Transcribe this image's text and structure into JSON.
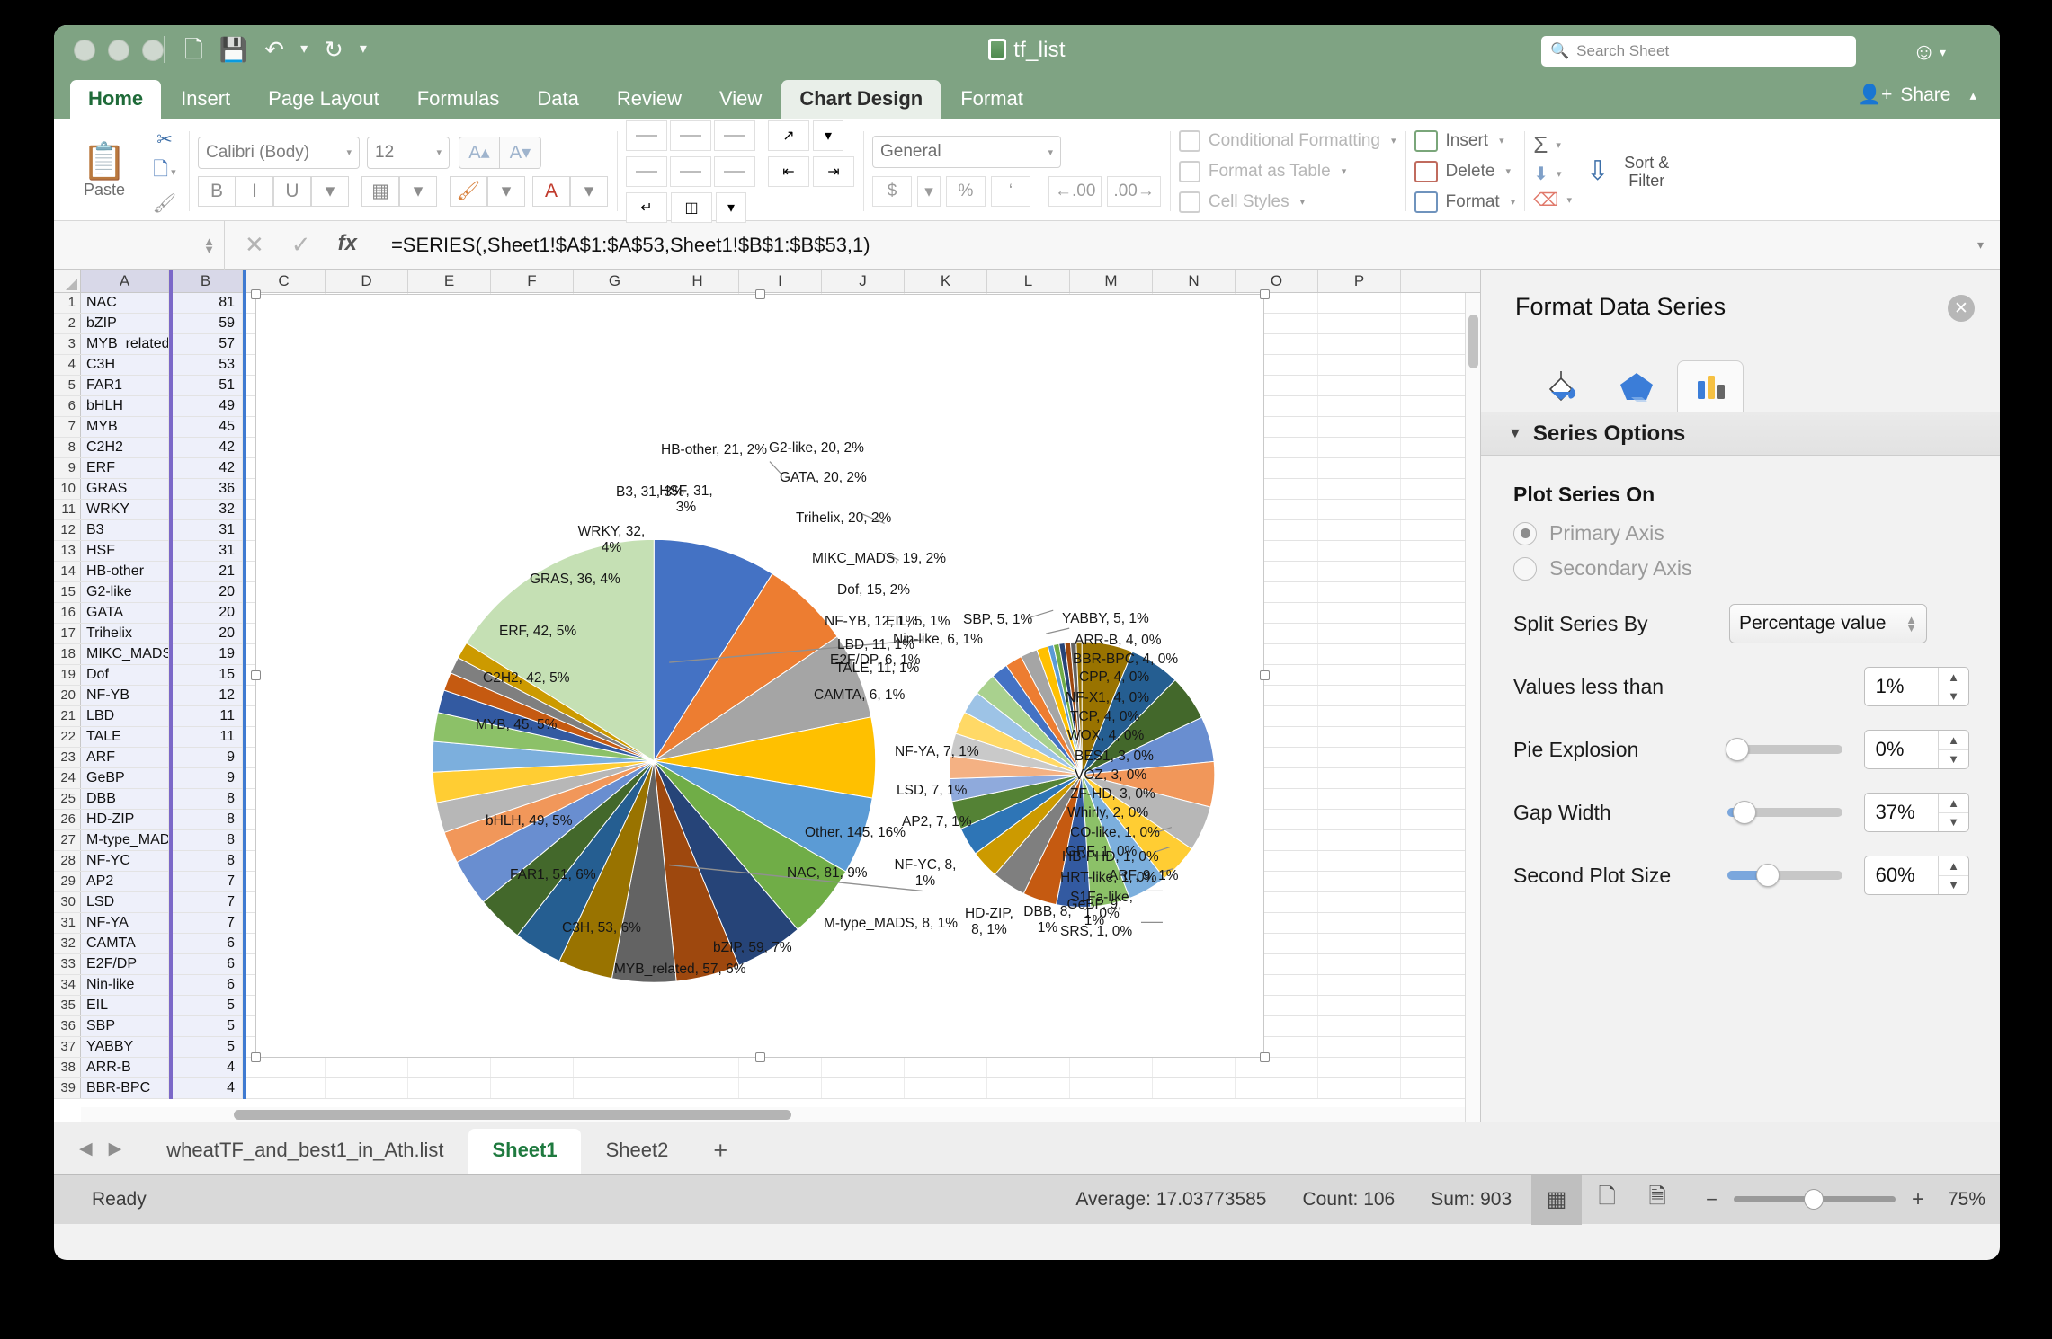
{
  "window": {
    "title": "tf_list",
    "search_placeholder": "Search Sheet",
    "quick_access": [
      "new-icon",
      "save-icon",
      "undo-icon",
      "redo-icon",
      "customize-icon"
    ],
    "share_label": "Share"
  },
  "ribbon": {
    "tabs": [
      {
        "label": "Home",
        "state": "active"
      },
      {
        "label": "Insert",
        "state": "normal"
      },
      {
        "label": "Page Layout",
        "state": "normal"
      },
      {
        "label": "Formulas",
        "state": "normal"
      },
      {
        "label": "Data",
        "state": "normal"
      },
      {
        "label": "Review",
        "state": "normal"
      },
      {
        "label": "View",
        "state": "normal"
      },
      {
        "label": "Chart Design",
        "state": "contextual"
      },
      {
        "label": "Format",
        "state": "contextual-plain"
      }
    ],
    "clipboard": {
      "paste_label": "Paste"
    },
    "font": {
      "name": "Calibri (Body)",
      "size": "12",
      "grow": "A",
      "shrink": "A",
      "bold": "B",
      "italic": "I",
      "underline": "U"
    },
    "number": {
      "format": "General",
      "currency": "$",
      "percent": "%",
      "comma": "'",
      "inc_dec": ".00",
      "dec_dec": ".00"
    },
    "styles": [
      {
        "label": "Conditional Formatting"
      },
      {
        "label": "Format as Table"
      },
      {
        "label": "Cell Styles"
      }
    ],
    "cells": [
      {
        "label": "Insert"
      },
      {
        "label": "Delete"
      },
      {
        "label": "Format"
      }
    ],
    "editing": {
      "sort_filter": "Sort & Filter"
    }
  },
  "formula_bar": {
    "name_box": "",
    "formula": "=SERIES(,Sheet1!$A$1:$A$53,Sheet1!$B$1:$B$53,1)"
  },
  "grid": {
    "columns": [
      "A",
      "B",
      "C",
      "D",
      "E",
      "F",
      "G",
      "H",
      "I",
      "J",
      "K",
      "L",
      "M",
      "N",
      "O",
      "P"
    ],
    "selected_columns": [
      "A",
      "B"
    ],
    "rows": [
      {
        "n": 1,
        "a": "NAC",
        "b": "81"
      },
      {
        "n": 2,
        "a": "bZIP",
        "b": "59"
      },
      {
        "n": 3,
        "a": "MYB_related",
        "b": "57"
      },
      {
        "n": 4,
        "a": "C3H",
        "b": "53"
      },
      {
        "n": 5,
        "a": "FAR1",
        "b": "51"
      },
      {
        "n": 6,
        "a": "bHLH",
        "b": "49"
      },
      {
        "n": 7,
        "a": "MYB",
        "b": "45"
      },
      {
        "n": 8,
        "a": "C2H2",
        "b": "42"
      },
      {
        "n": 9,
        "a": "ERF",
        "b": "42"
      },
      {
        "n": 10,
        "a": "GRAS",
        "b": "36"
      },
      {
        "n": 11,
        "a": "WRKY",
        "b": "32"
      },
      {
        "n": 12,
        "a": "B3",
        "b": "31"
      },
      {
        "n": 13,
        "a": "HSF",
        "b": "31"
      },
      {
        "n": 14,
        "a": "HB-other",
        "b": "21"
      },
      {
        "n": 15,
        "a": "G2-like",
        "b": "20"
      },
      {
        "n": 16,
        "a": "GATA",
        "b": "20"
      },
      {
        "n": 17,
        "a": "Trihelix",
        "b": "20"
      },
      {
        "n": 18,
        "a": "MIKC_MADS",
        "b": "19"
      },
      {
        "n": 19,
        "a": "Dof",
        "b": "15"
      },
      {
        "n": 20,
        "a": "NF-YB",
        "b": "12"
      },
      {
        "n": 21,
        "a": "LBD",
        "b": "11"
      },
      {
        "n": 22,
        "a": "TALE",
        "b": "11"
      },
      {
        "n": 23,
        "a": "ARF",
        "b": "9"
      },
      {
        "n": 24,
        "a": "GeBP",
        "b": "9"
      },
      {
        "n": 25,
        "a": "DBB",
        "b": "8"
      },
      {
        "n": 26,
        "a": "HD-ZIP",
        "b": "8"
      },
      {
        "n": 27,
        "a": "M-type_MADS",
        "b": "8"
      },
      {
        "n": 28,
        "a": "NF-YC",
        "b": "8"
      },
      {
        "n": 29,
        "a": "AP2",
        "b": "7"
      },
      {
        "n": 30,
        "a": "LSD",
        "b": "7"
      },
      {
        "n": 31,
        "a": "NF-YA",
        "b": "7"
      },
      {
        "n": 32,
        "a": "CAMTA",
        "b": "6"
      },
      {
        "n": 33,
        "a": "E2F/DP",
        "b": "6"
      },
      {
        "n": 34,
        "a": "Nin-like",
        "b": "6"
      },
      {
        "n": 35,
        "a": "EIL",
        "b": "5"
      },
      {
        "n": 36,
        "a": "SBP",
        "b": "5"
      },
      {
        "n": 37,
        "a": "YABBY",
        "b": "5"
      },
      {
        "n": 38,
        "a": "ARR-B",
        "b": "4"
      },
      {
        "n": 39,
        "a": "BBR-BPC",
        "b": "4"
      }
    ]
  },
  "chart_data": {
    "type": "pie",
    "variant": "pie-of-pie",
    "title": "",
    "total": 903,
    "main_pie": {
      "labels": [
        "NAC",
        "bZIP",
        "MYB_related",
        "C3H",
        "FAR1",
        "bHLH",
        "MYB",
        "C2H2",
        "ERF",
        "GRAS",
        "WRKY",
        "B3",
        "HSF",
        "HB-other",
        "G2-like",
        "GATA",
        "Trihelix",
        "MIKC_MADS",
        "Dof",
        "NF-YB",
        "LBD",
        "TALE",
        "Other"
      ],
      "values": [
        81,
        59,
        57,
        53,
        51,
        49,
        45,
        42,
        42,
        36,
        32,
        31,
        31,
        21,
        20,
        20,
        20,
        19,
        15,
        12,
        11,
        11,
        145
      ],
      "percents": [
        "9%",
        "7%",
        "6%",
        "6%",
        "6%",
        "5%",
        "5%",
        "5%",
        "5%",
        "4%",
        "4%",
        "3%",
        "3%",
        "2%",
        "2%",
        "2%",
        "2%",
        "2%",
        "2%",
        "1%",
        "1%",
        "1%",
        "16%"
      ],
      "data_labels": [
        "NAC, 81, 9%",
        "bZIP, 59, 7%",
        "MYB_related, 57, 6%",
        "C3H, 53, 6%",
        "FAR1, 51, 6%",
        "bHLH, 49, 5%",
        "MYB, 45, 5%",
        "C2H2, 42, 5%",
        "ERF, 42, 5%",
        "GRAS, 36, 4%",
        "WRKY, 32, 4%",
        "B3, 31, 3%",
        "HSF, 31, 3%",
        "HB-other, 21, 2%",
        "G2-like, 20, 2%",
        "GATA, 20, 2%",
        "Trihelix, 20, 2%",
        "MIKC_MADS, 19, 2%",
        "Dof, 15, 2%",
        "NF-YB, 12, 1%",
        "LBD, 11, 1%",
        "TALE, 11, 1%",
        "Other, 145, 16%"
      ]
    },
    "secondary_pie": {
      "labels": [
        "ARF",
        "GeBP",
        "DBB",
        "HD-ZIP",
        "M-type_MADS",
        "NF-YC",
        "AP2",
        "LSD",
        "NF-YA",
        "CAMTA",
        "E2F/DP",
        "Nin-like",
        "EIL",
        "SBP",
        "YABBY",
        "ARR-B",
        "BBR-BPC",
        "CPP",
        "NF-X1",
        "TCP",
        "WOX",
        "BES1",
        "VOZ",
        "ZF-HD",
        "Whirly",
        "CO-like",
        "GRF",
        "HB-PHD",
        "HRT-like",
        "S1Fa-like",
        "SRS"
      ],
      "values": [
        9,
        9,
        8,
        8,
        8,
        8,
        7,
        7,
        7,
        6,
        6,
        6,
        5,
        5,
        5,
        4,
        4,
        4,
        4,
        4,
        4,
        3,
        3,
        3,
        2,
        1,
        1,
        1,
        1,
        1,
        1
      ],
      "percents": [
        "1%",
        "1%",
        "1%",
        "1%",
        "1%",
        "1%",
        "1%",
        "1%",
        "1%",
        "1%",
        "1%",
        "1%",
        "1%",
        "1%",
        "1%",
        "0%",
        "0%",
        "0%",
        "0%",
        "0%",
        "0%",
        "0%",
        "0%",
        "0%",
        "0%",
        "0%",
        "0%",
        "0%",
        "0%",
        "0%",
        "0%"
      ],
      "data_labels": [
        "ARF, 9, 1%",
        "GeBP, 9, 1%",
        "DBB, 8, 1%",
        "HD-ZIP, 8, 1%",
        "M-type_MADS, 8, 1%",
        "NF-YC, 8, 1%",
        "AP2, 7, 1%",
        "LSD, 7, 1%",
        "NF-YA, 7, 1%",
        "CAMTA, 6, 1%",
        "E2F/DP, 6, 1%",
        "Nin-like, 6, 1%",
        "EIL, 5, 1%",
        "SBP, 5, 1%",
        "YABBY, 5, 1%",
        "ARR-B, 4, 0%",
        "BBR-BPC, 4, 0%",
        "CPP, 4, 0%",
        "NF-X1, 4, 0%",
        "TCP, 4, 0%",
        "WOX, 4, 0%",
        "BES1, 3, 0%",
        "VOZ, 3, 0%",
        "ZF-HD, 3, 0%",
        "Whirly, 2, 0%",
        "CO-like, 1, 0%",
        "GRF, 1, 0%",
        "HB-PHD, 1, 0%",
        "HRT-like, 1, 0%",
        "S1Fa-like, 1, 0%",
        "SRS, 1, 0%"
      ]
    },
    "palette": [
      "#4472c4",
      "#ed7d31",
      "#a5a5a5",
      "#ffc000",
      "#5b9bd5",
      "#70ad47",
      "#264478",
      "#9e480e",
      "#636363",
      "#997300",
      "#255e91",
      "#43682b",
      "#698ed0",
      "#f1975a",
      "#b7b7b7",
      "#ffcd33",
      "#7cafdd",
      "#8cc168",
      "#335aa1",
      "#c55a11",
      "#7f7f7f",
      "#cc9a00",
      "#2e75b6",
      "#548235",
      "#8faadc",
      "#f4b183",
      "#c9c9c9",
      "#ffd966",
      "#9dc3e6",
      "#a9d18e"
    ],
    "other_slice_color": "#c5e0b4",
    "legend": "none",
    "data_label_format": "category, value, percentage"
  },
  "panel": {
    "title": "Format Data Series",
    "close": "✕",
    "tabs": [
      "fill-bucket-icon",
      "effects-pentagon-icon",
      "series-options-chart-icon"
    ],
    "active_tab_index": 2,
    "section_header": "Series Options",
    "plot_series_on_label": "Plot Series On",
    "radios": [
      {
        "label": "Primary Axis",
        "selected": true
      },
      {
        "label": "Secondary Axis",
        "selected": false
      }
    ],
    "fields": [
      {
        "label": "Split Series By",
        "value": "Percentage value",
        "type": "select"
      },
      {
        "label": "Values less than",
        "value": "1%",
        "type": "stepper"
      },
      {
        "label": "Pie Explosion",
        "value": "0%",
        "type": "slider-stepper",
        "fill_pct": 0
      },
      {
        "label": "Gap Width",
        "value": "37%",
        "type": "slider-stepper",
        "fill_pct": 8
      },
      {
        "label": "Second Plot Size",
        "value": "60%",
        "type": "slider-stepper",
        "fill_pct": 38
      }
    ]
  },
  "sheet_tabs": {
    "items": [
      {
        "label": "wheatTF_and_best1_in_Ath.list",
        "active": false
      },
      {
        "label": "Sheet1",
        "active": true
      },
      {
        "label": "Sheet2",
        "active": false
      }
    ],
    "add_label": "+"
  },
  "status_bar": {
    "status": "Ready",
    "average": "Average: 17.03773585",
    "count": "Count: 106",
    "sum": "Sum: 903",
    "zoom": "75%",
    "zoom_out": "−",
    "zoom_in": "+",
    "views": [
      "normal-view-icon",
      "page-layout-icon",
      "page-break-icon"
    ]
  }
}
